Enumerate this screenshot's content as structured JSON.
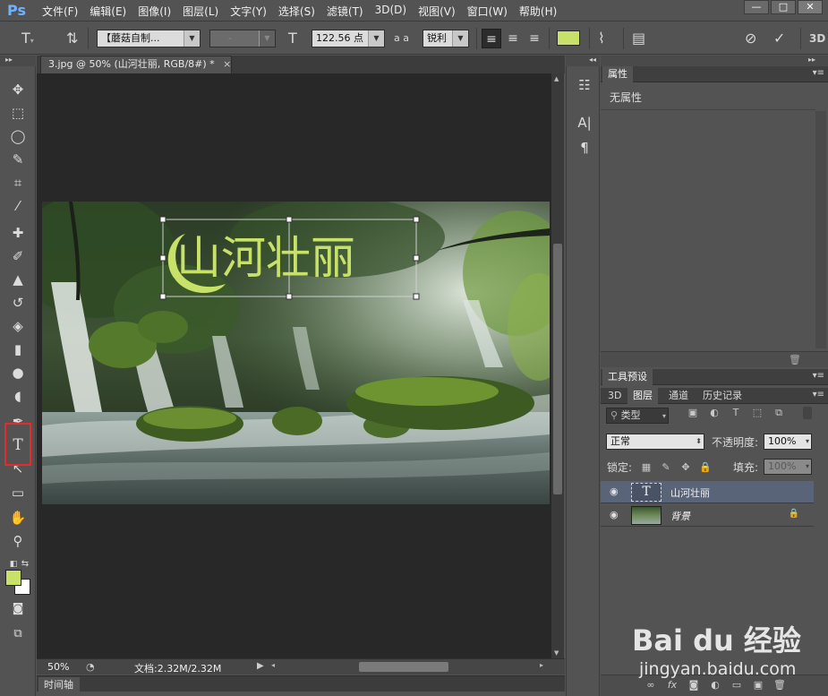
{
  "app": {
    "logo": "Ps"
  },
  "menubar": {
    "items": [
      "文件(F)",
      "编辑(E)",
      "图像(I)",
      "图层(L)",
      "文字(Y)",
      "选择(S)",
      "滤镜(T)",
      "3D(D)",
      "视图(V)",
      "窗口(W)",
      "帮助(H)"
    ],
    "window_controls": [
      "—",
      "□",
      "✕"
    ]
  },
  "options": {
    "font_family": "【蘑菇自制...",
    "font_style": "-",
    "font_size": "122.56 点",
    "antialias_icon_label": "a a",
    "antialias": "锐利",
    "text_color": "#c8e169"
  },
  "toolbar": {
    "fg_color": "#c8e169",
    "bg_color": "#ffffff",
    "type_tool_glyph": "T"
  },
  "document": {
    "tab_title": "3.jpg @ 50% (山河壮丽, RGB/8#) *",
    "tab_close": "×",
    "headline": "山河壮丽",
    "zoom": "50%",
    "doc_info": "文档:2.32M/2.32M"
  },
  "timeline": {
    "label": "时间轴"
  },
  "properties": {
    "tab": "属性",
    "empty_text": "无属性"
  },
  "presets": {
    "tab": "工具预设"
  },
  "layers_panel": {
    "tabs": [
      "3D",
      "图层",
      "通道",
      "历史记录"
    ],
    "filter_kind": "类型",
    "blend_mode": "正常",
    "opacity_label": "不透明度:",
    "opacity": "100%",
    "lock_label": "锁定:",
    "fill_label": "填充:",
    "fill": "100%",
    "layers": [
      {
        "name": "山河壮丽",
        "kind": "text",
        "selected": true,
        "thumb_glyph": "T"
      },
      {
        "name": "背景",
        "kind": "image",
        "selected": false,
        "locked": true
      }
    ]
  },
  "watermark": {
    "logo": "Bai du 经验",
    "url": "jingyan.baidu.com"
  }
}
